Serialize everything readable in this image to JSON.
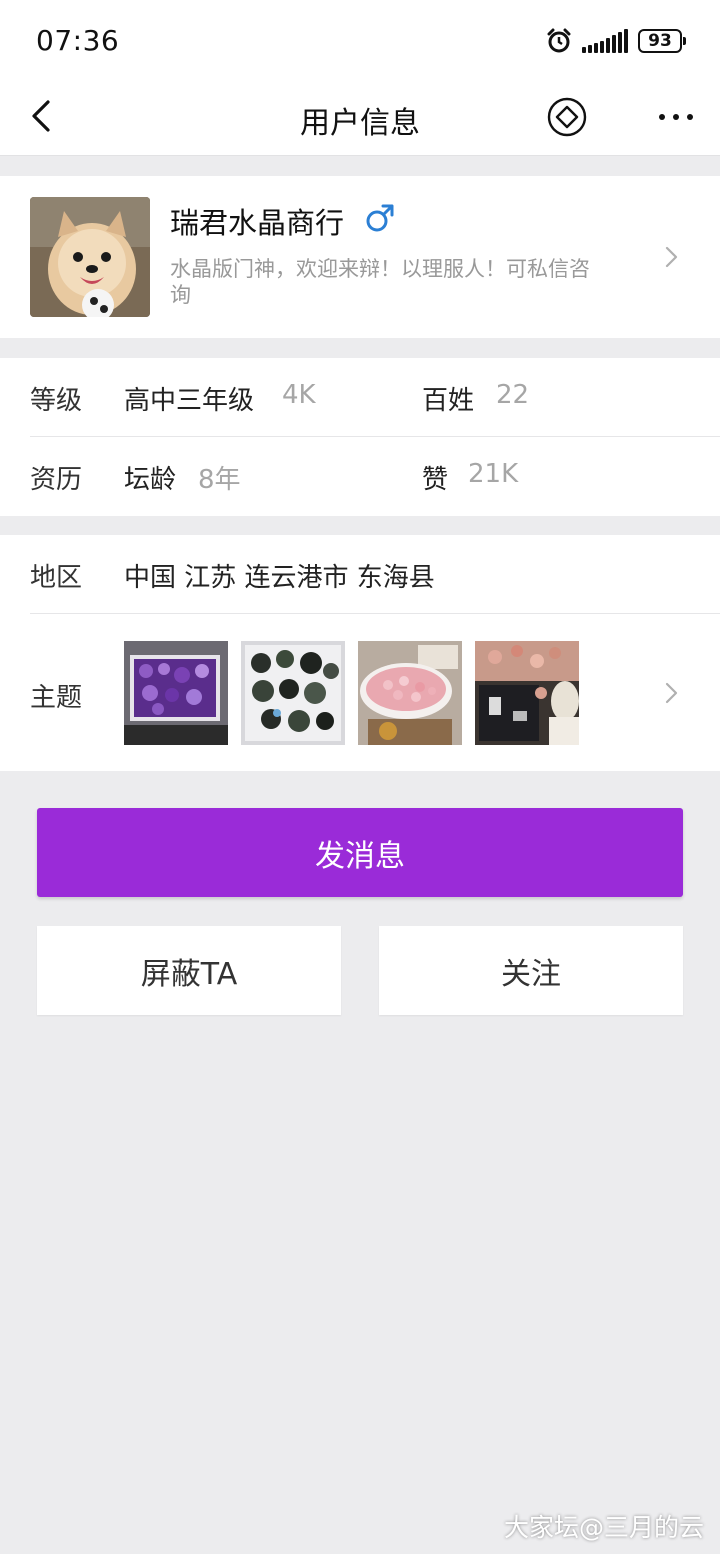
{
  "status_bar": {
    "time": "07:36",
    "battery": "93"
  },
  "nav": {
    "title": "用户信息"
  },
  "profile": {
    "name": "瑞君水晶商行",
    "bio": "水晶版门神，欢迎来辩！以理服人！可私信咨询"
  },
  "stats": {
    "level_label": "等级",
    "grade": "高中三年级",
    "grade_value": "4K",
    "baixing_label": "百姓",
    "baixing_value": "22",
    "tenure_label": "资历",
    "forum_age_label": "坛龄",
    "forum_age_value": "8年",
    "likes_label": "赞",
    "likes_value": "21K"
  },
  "region": {
    "label": "地区",
    "value": "中国 江苏 连云港市 东海县"
  },
  "topics": {
    "label": "主题"
  },
  "buttons": {
    "message": "发消息",
    "block": "屏蔽TA",
    "follow": "关注"
  },
  "watermark": "大家坛@三月的云",
  "colors": {
    "accent": "#9a2bd8",
    "gender": "#2b7fd4",
    "background": "#ececee"
  }
}
